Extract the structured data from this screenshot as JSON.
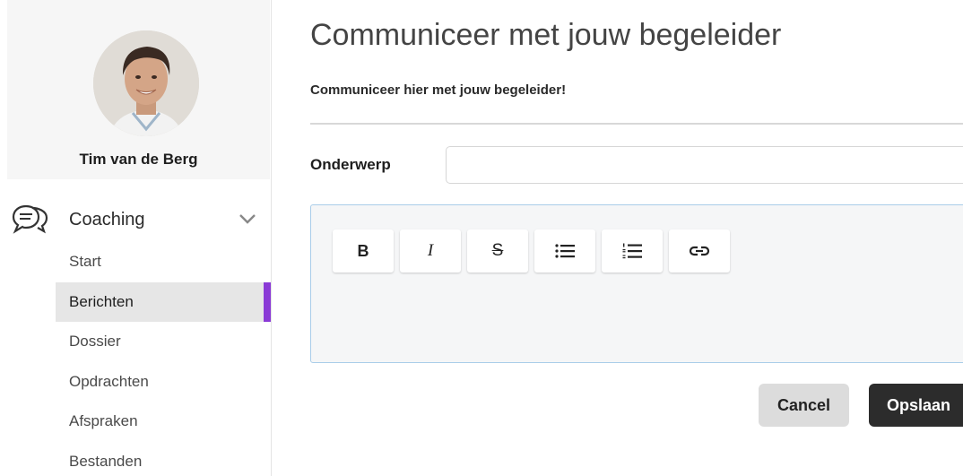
{
  "profile": {
    "name": "Tim van de Berg"
  },
  "nav": {
    "section_title": "Coaching",
    "items": [
      {
        "label": "Start"
      },
      {
        "label": "Berichten",
        "active": true
      },
      {
        "label": "Dossier"
      },
      {
        "label": "Opdrachten"
      },
      {
        "label": "Afspraken"
      },
      {
        "label": "Bestanden"
      }
    ],
    "active_color": "#8a3ad6"
  },
  "main": {
    "title": "Communiceer met jouw begeleider",
    "subtitle": "Communiceer hier met jouw begeleider!",
    "subject_label": "Onderwerp",
    "subject_value": "",
    "editor_focus_color": "#a9cde9",
    "toolbar": {
      "bold_label": "B",
      "italic_label": "I",
      "strike_label": "S",
      "icons": [
        "bold-icon",
        "italic-icon",
        "strikethrough-icon",
        "bullet-list-icon",
        "numbered-list-icon",
        "link-icon"
      ]
    },
    "actions": {
      "cancel_label": "Cancel",
      "save_label": "Opslaan"
    }
  }
}
